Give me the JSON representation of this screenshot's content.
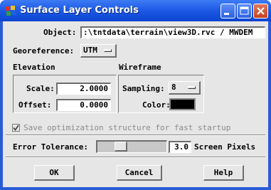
{
  "window": {
    "title": "Surface Layer Controls"
  },
  "object": {
    "label": "Object:",
    "value": ":\\tntdata\\terrain\\view3D.rvc / MWDEM"
  },
  "georeference": {
    "label": "Georeference:",
    "value": "UTM"
  },
  "elevation": {
    "heading": "Elevation",
    "scale_label": "Scale:",
    "scale_value": "2.0000",
    "offset_label": "Offset:",
    "offset_value": "0.0000"
  },
  "wireframe": {
    "heading": "Wireframe",
    "sampling_label": "Sampling:",
    "sampling_value": "8",
    "color_label": "Color:",
    "color_value": "#000000"
  },
  "optimization": {
    "label": "Save optimization structure for fast startup",
    "checked": true
  },
  "tolerance": {
    "label": "Error Tolerance:",
    "value": "3.0",
    "units": "Screen Pixels",
    "slider_level": 0.3
  },
  "buttons": {
    "ok": "OK",
    "cancel": "Cancel",
    "help": "Help"
  }
}
